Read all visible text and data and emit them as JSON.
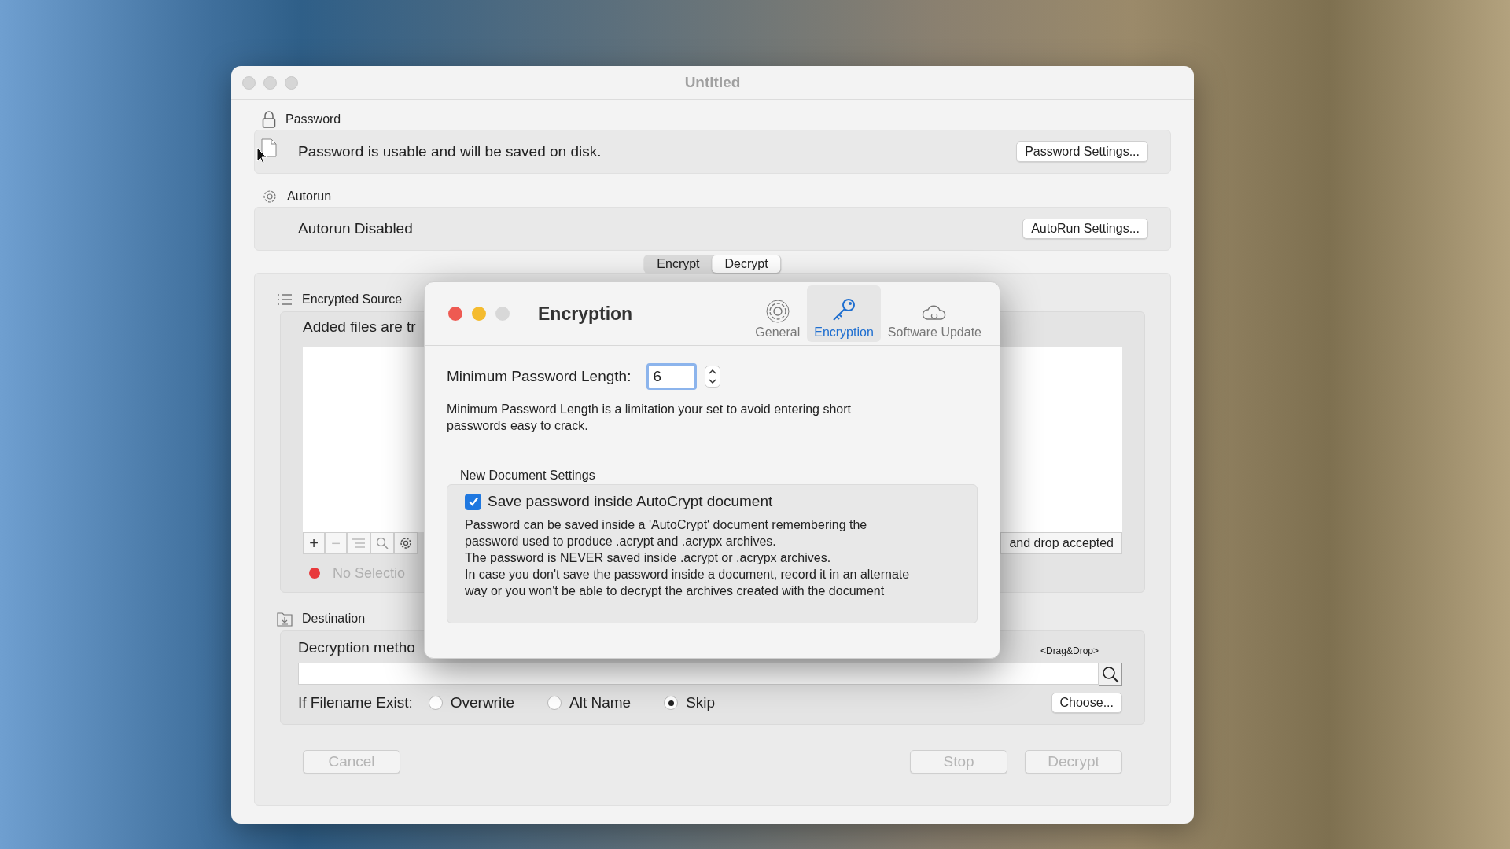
{
  "main_window": {
    "title": "Untitled",
    "sections": [
      {
        "kind": "password",
        "label": "Password",
        "status": "Password is usable and will be saved on disk.",
        "button": "Password Settings..."
      },
      {
        "kind": "autorun",
        "label": "Autorun",
        "status": "Autorun Disabled",
        "button": "AutoRun Settings..."
      }
    ],
    "mode_tabs": [
      {
        "label": "Encrypt",
        "selected": false
      },
      {
        "label": "Decrypt",
        "selected": true
      }
    ],
    "sources": {
      "header": "Encrypted Source",
      "hint": "Added files are tr",
      "drop_hint": "and drop accepted",
      "selection": "No Selectio",
      "tools": [
        {
          "symbol": "+",
          "disabled": false
        },
        {
          "symbol": "−",
          "disabled": true
        }
      ]
    },
    "destination": {
      "header": "Destination",
      "method_label": "Decryption metho",
      "drag_hint": "<Drag&Drop>",
      "choose_button": "Choose...",
      "exist_label": "If Filename Exist:",
      "options": [
        {
          "label": "Overwrite",
          "selected": false
        },
        {
          "label": "Alt Name",
          "selected": false
        },
        {
          "label": "Skip",
          "selected": true
        }
      ]
    },
    "buttons": [
      {
        "label": "Cancel",
        "disabled": true
      },
      {
        "label": "Stop",
        "disabled": true
      },
      {
        "label": "Decrypt",
        "disabled": true
      }
    ]
  },
  "prefs_dialog": {
    "title": "Encryption",
    "tabs": [
      {
        "label": "General",
        "selected": false
      },
      {
        "label": "Encryption",
        "selected": true
      },
      {
        "label": "Software Update",
        "selected": false
      }
    ],
    "min_length_label": "Minimum Password Length:",
    "min_length_value": "6",
    "min_length_help": "Minimum Password Length is a limitation your set to avoid entering short\npasswords easy to crack.",
    "group_title": "New Document Settings",
    "save_password": {
      "label": "Save password inside AutoCrypt document",
      "checked": true
    },
    "save_password_help": "Password can be saved inside a 'AutoCrypt' document remembering the\npassword used to produce .acrypt and .acrypx archives.\nThe password is NEVER saved inside .acrypt or .acrypx archives.\nIn case you don't save the password inside a document, record it in an alternate\nway or you won't be able to decrypt the archives created with the document"
  }
}
